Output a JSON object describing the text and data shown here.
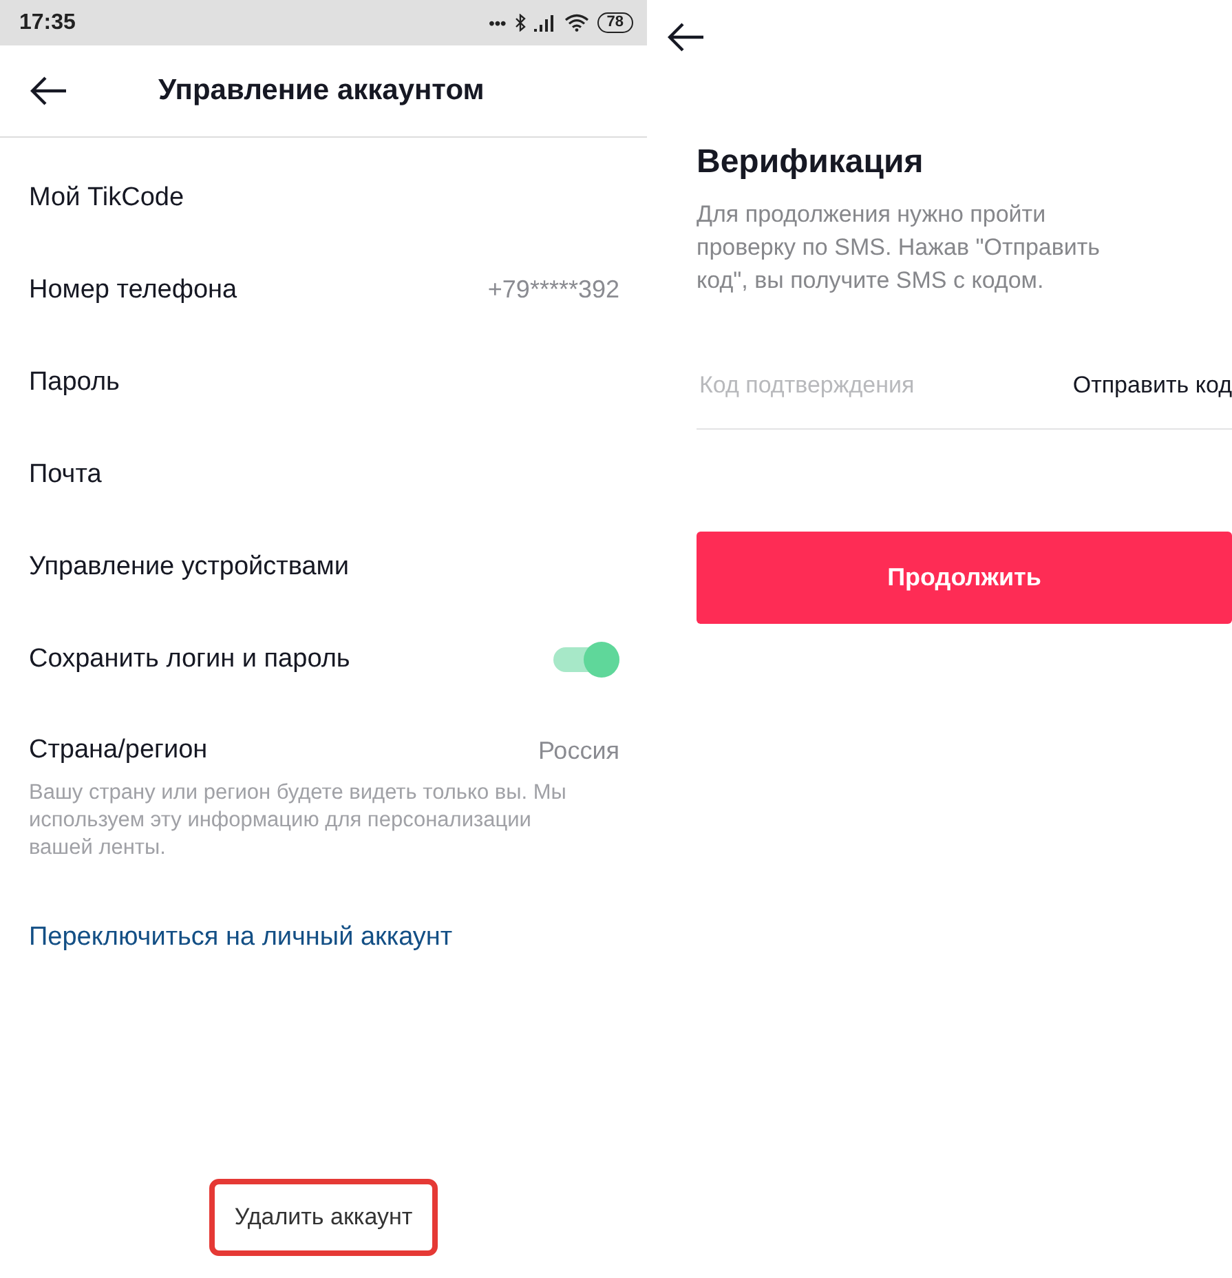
{
  "status_bar": {
    "time": "17:35",
    "more": "•••",
    "battery": "78"
  },
  "account_screen": {
    "title": "Управление аккаунтом",
    "items": [
      {
        "kind": "link",
        "label": "Мой TikCode"
      },
      {
        "kind": "value",
        "label": "Номер телефона",
        "value": "+79*****392"
      },
      {
        "kind": "link",
        "label": "Пароль"
      },
      {
        "kind": "link",
        "label": "Почта"
      },
      {
        "kind": "link",
        "label": "Управление устройствами"
      },
      {
        "kind": "toggle",
        "label": "Сохранить логин и пароль",
        "on": true
      },
      {
        "kind": "value",
        "label": "Страна/регион",
        "value": "Россия",
        "description": "Вашу страну или регион будете видеть только вы. Мы используем эту информацию для персонализации вашей ленты."
      }
    ],
    "switch_link": "Переключиться на личный аккаунт",
    "delete_button": {
      "label": "Удалить аккаунт",
      "highlighted": true
    }
  },
  "verification_screen": {
    "title": "Верификация",
    "description": "Для продолжения нужно пройти проверку по SMS. Нажав \"Отправить код\", вы получите SMS с кодом.",
    "code_field": {
      "placeholder": "Код подтверждения"
    },
    "send_code": "Отправить код",
    "continue_button": "Продолжить"
  }
}
